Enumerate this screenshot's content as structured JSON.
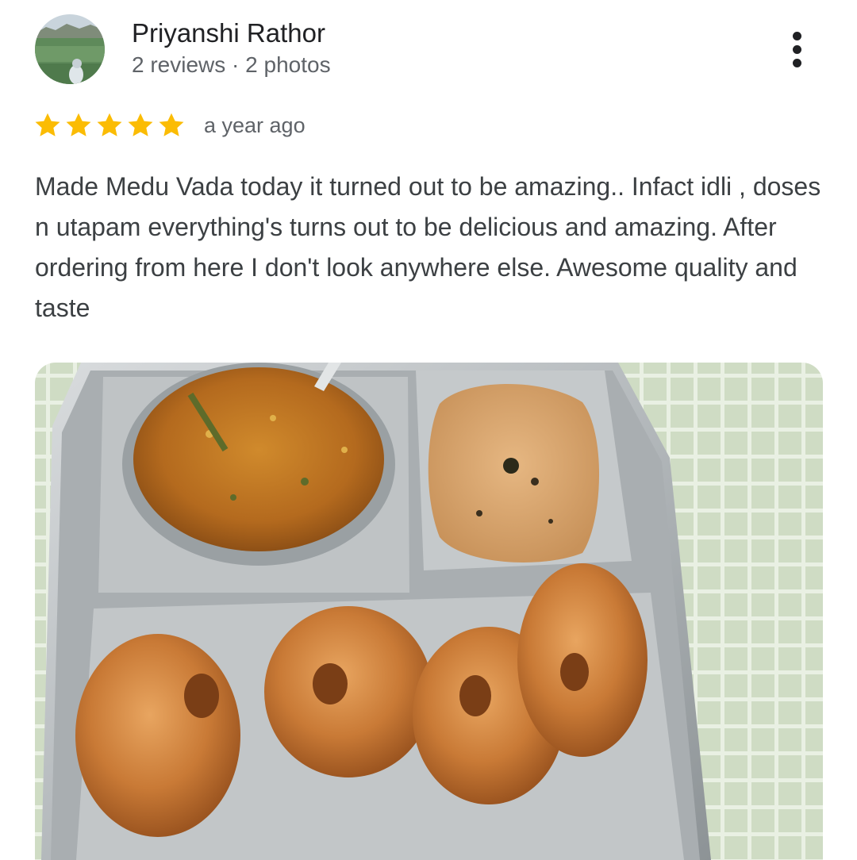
{
  "reviewer": {
    "name": "Priyanshi Rathor",
    "meta": "2 reviews · 2 photos",
    "avatar_icon": "lake-landscape-avatar"
  },
  "menu": {
    "icon": "more-vert-icon"
  },
  "rating": {
    "stars": 5,
    "max_stars": 5,
    "star_color": "#fbbc04",
    "time": "a year ago"
  },
  "review": {
    "text": "Made Medu Vada today it turned out to be amazing.. Infact idli , doses n utapam everything's turns out to be delicious and amazing. After ordering from here I don't look anywhere else. Awesome quality and taste"
  },
  "photo": {
    "subject": "medu-vada-plate-photo"
  }
}
